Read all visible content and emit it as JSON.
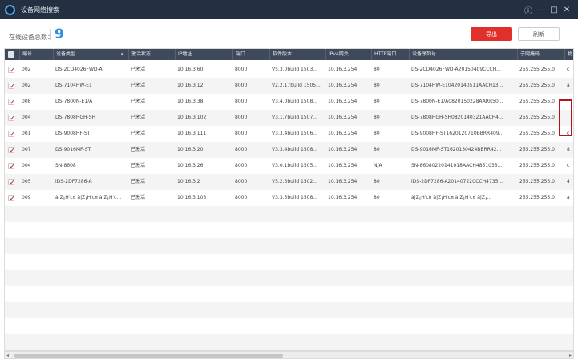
{
  "window": {
    "title": "设备网络搜索",
    "controls": [
      "ⓘ",
      "—",
      "□",
      "✕"
    ]
  },
  "toolbar": {
    "online_label": "在线设备总数：",
    "online_count": "9",
    "export_label": "导出",
    "refresh_label": "刷新"
  },
  "table": {
    "columns": [
      "编号",
      "设备类型",
      "激活状态",
      "IP地址",
      "端口",
      "软件版本",
      "IPv4网关",
      "HTTP端口",
      "设备序列号",
      "子网掩码",
      "物"
    ],
    "rows": [
      [
        "002",
        "DS-2CD4026FWD-A",
        "已激活",
        "10.16.3.60",
        "8000",
        "V5.3.0build 1503...",
        "10.16.3.254",
        "80",
        "DS-2CD4026FWD-A20150409CCCH...",
        "255.255.255.0",
        "c"
      ],
      [
        "002",
        "DS-7104HW-E1",
        "已激活",
        "10.16.3.12",
        "8000",
        "V2.2.17build 1505...",
        "10.16.3.254",
        "80",
        "DS-7104HW-E10420140511AACH13...",
        "255.255.255.0",
        "a"
      ],
      [
        "008",
        "DS-7800N-E1/A",
        "已激活",
        "10.16.3.38",
        "8000",
        "V3.4.0build 1508...",
        "10.16.3.254",
        "80",
        "DS-7800N-E1/A0820150228AARR50...",
        "255.255.255.0",
        ""
      ],
      [
        "004",
        "DS-7808HGH-SH",
        "已激活",
        "10.16.3.102",
        "8000",
        "V3.1.7build 1507...",
        "10.16.3.254",
        "80",
        "DS-7808HGH-SH0820140321AACH4...",
        "255.255.255.0",
        ""
      ],
      [
        "001",
        "DS-9008HF-ST",
        "已激活",
        "10.16.3.111",
        "8000",
        "V3.3.4build 1506...",
        "10.16.3.254",
        "80",
        "DS-9008HF-ST1620120710BBRR409...",
        "255.255.255.0",
        "c"
      ],
      [
        "007",
        "DS-9016MF-ST",
        "已激活",
        "10.16.3.20",
        "8000",
        "V3.3.4build 1508...",
        "10.16.3.254",
        "80",
        "DS-9016MF-ST1620130424BBRR42...",
        "255.255.255.0",
        "8"
      ],
      [
        "004",
        "SN-8608",
        "已激活",
        "10.16.3.26",
        "8000",
        "V3.0.1build 1505...",
        "10.16.3.254",
        "N/A",
        "SN-86080220141018AACH4851033...",
        "255.255.255.0",
        "c"
      ],
      [
        "005",
        "iDS-2DF7286-A",
        "已激活",
        "10.16.3.2",
        "8000",
        "V5.2.3build 1502...",
        "10.16.3.254",
        "80",
        "iDS-2DF7286-A20140722CCCH4735...",
        "255.255.255.0",
        "4"
      ],
      [
        "009",
        "à|Z¡H'c¤ à|Z¡H'c¤ à|Z¡H'c...",
        "已激活",
        "10.16.3.103",
        "8000",
        "V3.3.5build 1508...",
        "10.16.3.254",
        "80",
        "à|Z¡H'c¤ à|Z¡H'c¤ à|Z¡H'c¤ à|Z¡...",
        "255.255.255.0",
        "a"
      ]
    ]
  },
  "colors": {
    "titlebar": "#243041",
    "header": "#3e4a59",
    "accent_blue": "#2f8ee0",
    "export_red": "#e0302b",
    "highlight_red": "#b8121a"
  }
}
